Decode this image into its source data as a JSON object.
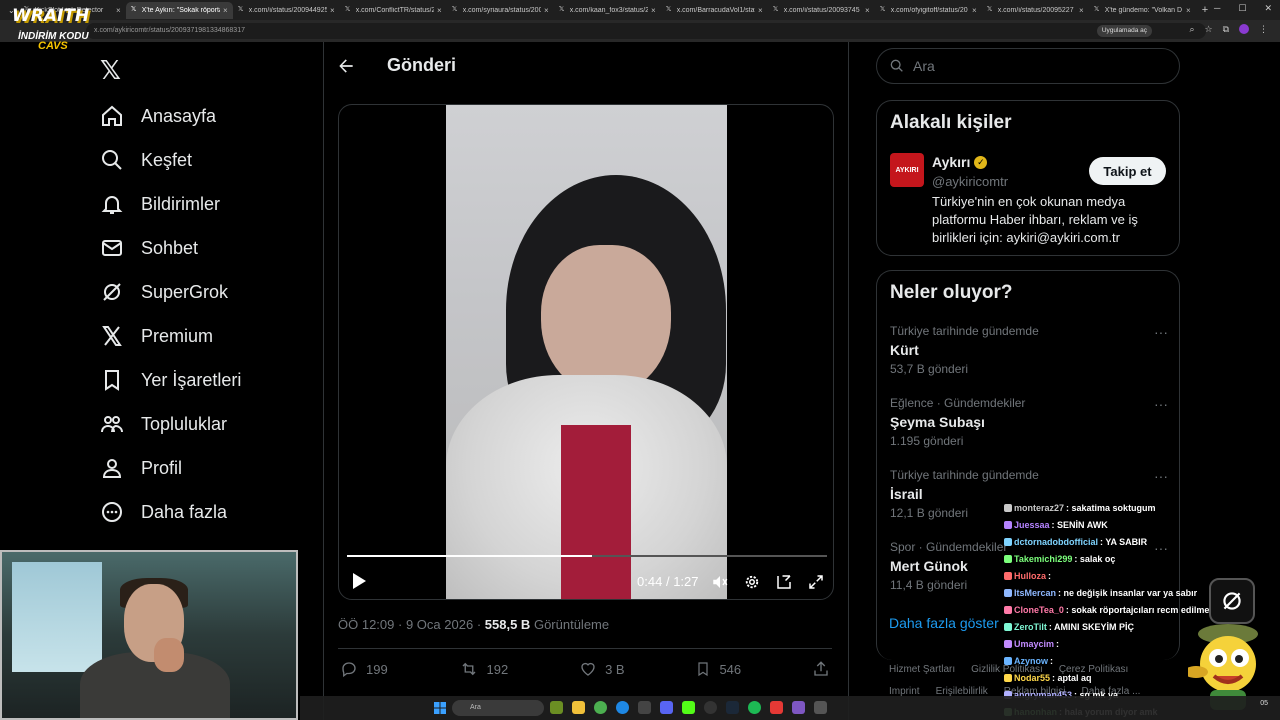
{
  "browser": {
    "tabs": [
      {
        "label": "KickSlot Link Detector",
        "active": false
      },
      {
        "label": "X'te Aykırı: \"Sokak röportaj",
        "active": true
      },
      {
        "label": "x.com/i/status/200944925",
        "active": false
      },
      {
        "label": "x.com/ConflictTR/status/2",
        "active": false
      },
      {
        "label": "x.com/syriaura/status/200",
        "active": false
      },
      {
        "label": "x.com/kaan_fox3/status/2",
        "active": false
      },
      {
        "label": "x.com/BarracudaVol1/stat",
        "active": false
      },
      {
        "label": "x.com/i/status/20093745",
        "active": false
      },
      {
        "label": "x.com/ofyigitoff/status/20",
        "active": false
      },
      {
        "label": "x.com/i/status/20095227",
        "active": false
      },
      {
        "label": "X'te gündemo: \"Volkan D",
        "active": false
      }
    ],
    "url": "x.com/aykiricomtr/status/2009371981334868317",
    "app_chip": "Uygulamada aç"
  },
  "overlay": {
    "brand": "WRAITH",
    "promo": "İNDİRİM KODU",
    "code": "CAVS"
  },
  "nav": {
    "items": [
      {
        "label": "Anasayfa",
        "icon": "home-icon"
      },
      {
        "label": "Keşfet",
        "icon": "search-icon"
      },
      {
        "label": "Bildirimler",
        "icon": "bell-icon"
      },
      {
        "label": "Sohbet",
        "icon": "mail-icon"
      },
      {
        "label": "SuperGrok",
        "icon": "grok-icon"
      },
      {
        "label": "Premium",
        "icon": "x-icon"
      },
      {
        "label": "Yer İşaretleri",
        "icon": "bookmark-icon"
      },
      {
        "label": "Topluluklar",
        "icon": "communities-icon"
      },
      {
        "label": "Profil",
        "icon": "profile-icon"
      },
      {
        "label": "Daha fazla",
        "icon": "more-icon"
      }
    ]
  },
  "post": {
    "header_title": "Gönderi",
    "video": {
      "current_time": "0:44",
      "separator": "/",
      "duration": "1:27",
      "progress": 0.51
    },
    "meta": {
      "time": "ÖÖ 12:09",
      "dot": "·",
      "date": "9 Oca 2026",
      "dot2": "·",
      "views": "558,5 B",
      "views_label": "Görüntüleme"
    },
    "actions": {
      "replies": "199",
      "reposts": "192",
      "likes": "3 B",
      "bookmarks": "546"
    }
  },
  "search": {
    "placeholder": "Ara"
  },
  "related": {
    "title": "Alakalı kişiler",
    "name": "Aykırı",
    "handle": "@aykiricomtr",
    "avatar_text": "AYKIRI",
    "follow_label": "Takip et",
    "bio": "Türkiye'nin en çok okunan medya platformu Haber ihbarı, reklam ve iş birlikleri için: aykiri@aykiri.com.tr"
  },
  "trends": {
    "title": "Neler oluyor?",
    "items": [
      {
        "category": "Türkiye tarihinde gündemde",
        "name": "Kürt",
        "count": "53,7 B gönderi"
      },
      {
        "category": "Eğlence · Gündemdekiler",
        "name": "Şeyma Subaşı",
        "count": "1.195 gönderi"
      },
      {
        "category": "Türkiye tarihinde gündemde",
        "name": "İsrail",
        "count": "12,1 B gönderi"
      },
      {
        "category": "Spor · Gündemdekiler",
        "name": "Mert Günok",
        "count": "11,4 B gönderi"
      }
    ],
    "show_more": "Daha fazla göster"
  },
  "footer": {
    "links1": [
      "Hizmet Şartları",
      "Gizlilik Politikası",
      "Çerez Politikası"
    ],
    "links2": [
      "Imprint",
      "Erişilebilirlik",
      "Reklam bilgisi",
      "Daha fazla ..."
    ]
  },
  "chat": {
    "messages": [
      {
        "user": "monteraz27",
        "text": ": sakatima soktugum",
        "color": "#c8c8c8"
      },
      {
        "user": "Juessaa",
        "text": ": SENİN AWK",
        "color": "#b583ff"
      },
      {
        "user": "dctornadobdofficial",
        "text": ": YA SABIR",
        "color": "#7fd4ff"
      },
      {
        "user": "Takemichi299",
        "text": ": salak oç",
        "color": "#7cff7c"
      },
      {
        "user": "Hulloza",
        "text": ":",
        "color": "#ff6b6b"
      },
      {
        "user": "ItsMercan",
        "text": ": ne değişik insanlar var ya sabır",
        "color": "#8fb8ff"
      },
      {
        "user": "CloneTea_0",
        "text": ": sokak röportajcıları recm edilmeli",
        "color": "#ff7aa8"
      },
      {
        "user": "ZeroTilt",
        "text": ": AMINI SKEYİM PİÇ",
        "color": "#7ff7d4"
      },
      {
        "user": "Umaycim",
        "text": ":",
        "color": "#c28bff"
      },
      {
        "user": "Azynow",
        "text": ":",
        "color": "#6ab4ff"
      },
      {
        "user": "Nodar55",
        "text": ": aptal aq",
        "color": "#ffd84a"
      },
      {
        "user": "angryman453",
        "text": ": sg mk ya",
        "color": "#b0b0ff"
      },
      {
        "user": "hanonhan",
        "text": ": hala yorum diyor amk",
        "color": "#9aff9a"
      }
    ]
  },
  "taskbar": {
    "search_placeholder": "Ara",
    "clock": "05"
  }
}
